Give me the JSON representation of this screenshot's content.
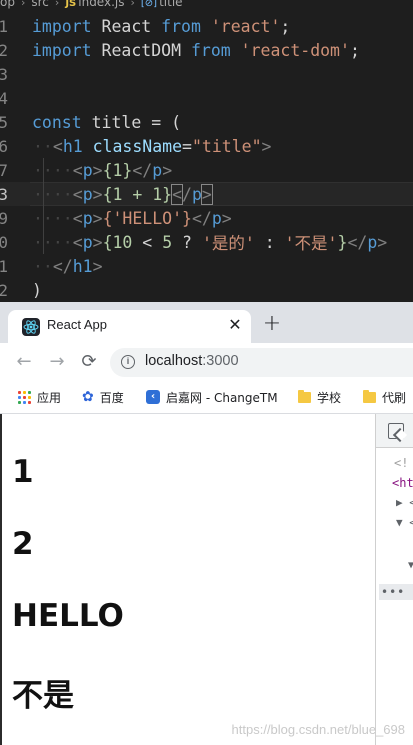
{
  "editor": {
    "breadcrumb": {
      "segments": [
        "op",
        "src",
        "index.js",
        "title"
      ],
      "file_badge": "JS",
      "symbol_badge": "[⊘]"
    },
    "line_numbers": [
      "1",
      "2",
      "3",
      "4",
      "5",
      "6",
      "7",
      "8",
      "9",
      "0",
      "1",
      "2"
    ],
    "active_line": "3",
    "code": {
      "kw_import": "import",
      "kw_from": "from",
      "id_react": "React",
      "str_react": "'react'",
      "id_reactdom": "ReactDOM",
      "str_reactdom": "'react-dom'",
      "semi": ";",
      "kw_const": "const",
      "id_title": "title",
      "op_eq": "=",
      "paren_open": "(",
      "paren_close": ")",
      "tag_h1": "h1",
      "attr_classname": "className",
      "str_title": "\"title\"",
      "tag_p": "p",
      "expr1": "{1}",
      "expr2": "{1 + 1}",
      "expr3": "{'HELLO'}",
      "expr4_open": "{",
      "expr4_num1": "10",
      "expr4_lt": " < ",
      "expr4_num2": "5",
      "expr4_q": " ? ",
      "expr4_yes": "'是的'",
      "expr4_colon": " : ",
      "expr4_no": "'不是'",
      "expr4_close": "}"
    }
  },
  "browser": {
    "tab": {
      "title": "React App",
      "close": "✕",
      "new_tab": "+"
    },
    "nav": {
      "back": "←",
      "forward": "→",
      "reload": "⟳"
    },
    "omnibox": {
      "info": "i",
      "host": "localhost",
      "port": ":3000"
    },
    "bookmarks": [
      {
        "label": "应用",
        "icon": "apps-grid-icon"
      },
      {
        "label": "百度",
        "icon": "baidu-paw-icon"
      },
      {
        "label": "启嘉网 - ChangeTM",
        "icon": "changetm-icon"
      },
      {
        "label": "学校",
        "icon": "folder-icon"
      },
      {
        "label": "代刷",
        "icon": "folder-icon"
      }
    ],
    "page": {
      "headings": [
        "1",
        "2",
        "HELLO",
        "不是"
      ]
    },
    "devtools": {
      "lines": [
        "<!",
        "<ht",
        "▶ <",
        "▼ <",
        "▼"
      ],
      "more": "•••"
    },
    "watermark": "https://blog.csdn.net/blue_698"
  },
  "colors": {
    "editor_bg": "#1e1e1e",
    "keyword": "#569cd6",
    "string": "#ce9178",
    "attribute": "#9cdcfe",
    "number": "#b5cea8",
    "tab_strip": "#dee1e6",
    "omnibox": "#f1f3f4"
  }
}
